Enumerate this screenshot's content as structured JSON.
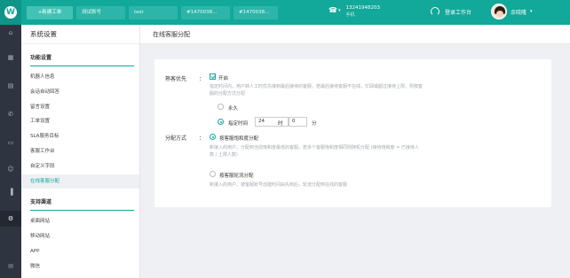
{
  "topbar": {
    "logo": "W",
    "tabs": [
      {
        "label": "+新建工单",
        "active": true
      },
      {
        "label": "测试账号",
        "active": false
      },
      {
        "label": "test",
        "active": false
      },
      {
        "label": "#1470038...",
        "active": false
      },
      {
        "label": "#1470038...",
        "active": false
      }
    ],
    "phone_number": "13241948203",
    "phone_label": "手机",
    "workspace_label": "登录工作台",
    "username": "余晓隆"
  },
  "sidebar": {
    "title": "系统设置",
    "groups": [
      {
        "label": "功能设置",
        "items": [
          "机器人信息",
          "会话自动回答",
          "留言设置",
          "工单设置",
          "SLA服务目标",
          "客服工作台",
          "自定义字段",
          "在线客服分配"
        ]
      },
      {
        "label": "支持渠道",
        "items": [
          "桌面网站",
          "移动网站",
          "APP",
          "微信"
        ]
      }
    ],
    "active_item": "在线客服分配"
  },
  "content": {
    "header": "在线客服分配",
    "familiar_priority": {
      "label": "熟客优先",
      "colon": "：",
      "checkbox_label": "开启",
      "help": "指定时间内，用户转人工时优先接到最后接待的客服，若最后接待客服不在线，忙碌或超过接待上限，则按客服的分配方式分配",
      "option_forever": "永久",
      "option_time": "指定时间",
      "hours": "24",
      "hours_unit": "时",
      "minutes": "0",
      "minutes_unit": "分"
    },
    "assign_mode": {
      "label": "分配方式",
      "colon": "：",
      "option1": "按客服饱和度分配",
      "help1": "新接入的用户，分配到当前饱和度最低的客服，若多个客服饱和度相同则随机分配 (接待饱和度 = 已接待人数 / 上限人数)",
      "option2": "按客服轮流分配",
      "help2": "新接入的用户，按客服账号创建时间由先到后，轮流分配到在线的客服"
    }
  }
}
